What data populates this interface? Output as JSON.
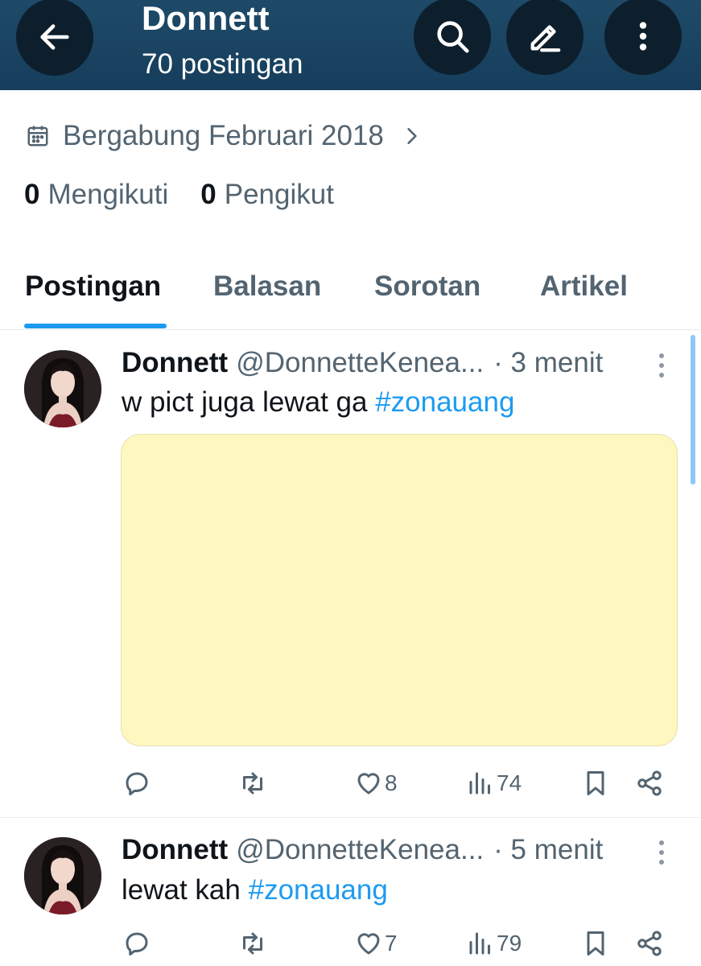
{
  "header": {
    "title": "Donnett",
    "subtitle": "70 postingan",
    "icons": [
      "back-arrow-icon",
      "search-icon",
      "edit-icon",
      "more-vertical-icon"
    ]
  },
  "profile": {
    "joined": "Bergabung Februari 2018",
    "following_count": "0",
    "following_label": "Mengikuti",
    "followers_count": "0",
    "followers_label": "Pengikut"
  },
  "tabs": [
    {
      "label": "Postingan",
      "active": true
    },
    {
      "label": "Balasan",
      "active": false
    },
    {
      "label": "Sorotan",
      "active": false
    },
    {
      "label": "Artikel",
      "active": false
    }
  ],
  "posts": [
    {
      "name": "Donnett",
      "handle": "@DonnetteKenea...",
      "time": "· 3 menit",
      "text": "w pict juga lewat ga",
      "hashtag": "#zonauang",
      "has_media": true,
      "media_color": "#fef8c0",
      "likes": "8",
      "views": "74"
    },
    {
      "name": "Donnett",
      "handle": "@DonnetteKenea...",
      "time": "· 5 menit",
      "text": "lewat kah",
      "hashtag": "#zonauang",
      "has_media": false,
      "likes": "7",
      "views": "79"
    }
  ],
  "colors": {
    "header_bg": "#1e4a68",
    "accent": "#1d9bf0",
    "muted_text": "#536471"
  }
}
